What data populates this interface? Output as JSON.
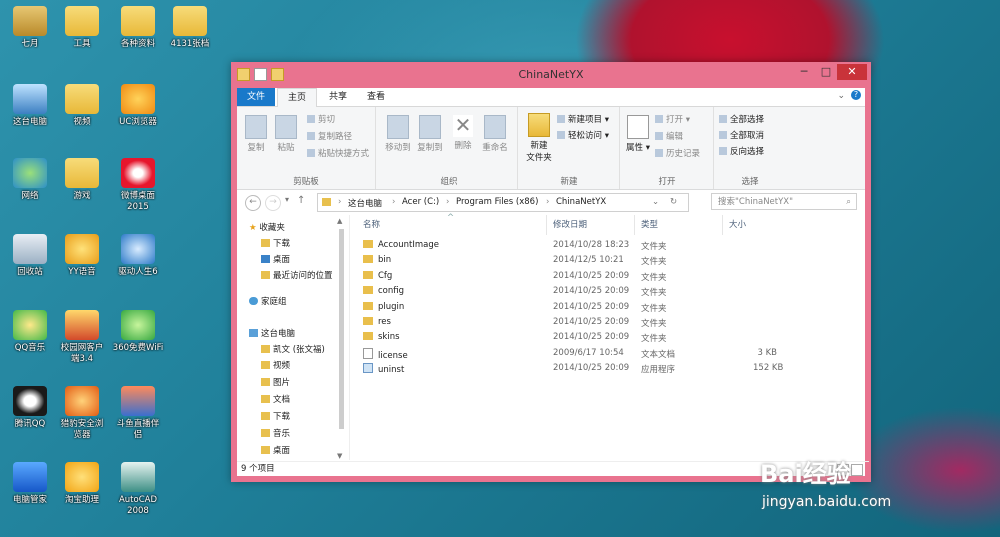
{
  "desktop": {
    "icons": [
      "七月",
      "工具",
      "各种资料",
      "4131张档",
      "这台电脑",
      "视频",
      "UC浏览器",
      "网络",
      "游戏",
      "微博桌面\n2015",
      "回收站",
      "YY语音",
      "驱动人生6",
      "QQ音乐",
      "校园网客户\n端3.4",
      "360免费WiFi",
      "腾讯QQ",
      "猎豹安全浏\n览器",
      "斗鱼直播伴\n侣",
      "电脑管家",
      "淘宝助理",
      "AutoCAD\n2008"
    ]
  },
  "window": {
    "title": "ChinaNetYX",
    "controls": {
      "minimize": "─",
      "maximize": "□",
      "close": "✕"
    },
    "tabs": {
      "file": "文件",
      "home": "主页",
      "share": "共享",
      "view": "查看"
    },
    "ribbon": {
      "clipboard": {
        "copy": "复制",
        "paste": "粘贴",
        "cut": "剪切",
        "copy_path": "复制路径",
        "paste_shortcut": "粘贴快捷方式",
        "label": "剪贴板"
      },
      "organize": {
        "move_to": "移动到",
        "copy_to": "复制到",
        "delete": "删除",
        "rename": "重命名",
        "label": "组织"
      },
      "new": {
        "new_folder": "新建\n文件夹",
        "new_item": "新建项目",
        "easy_access": "轻松访问",
        "label": "新建"
      },
      "open": {
        "properties": "属性",
        "open": "打开",
        "edit": "编辑",
        "history": "历史记录",
        "label": "打开"
      },
      "select": {
        "select_all": "全部选择",
        "select_none": "全部取消",
        "invert": "反向选择",
        "label": "选择"
      }
    },
    "address": {
      "crumbs": [
        "这台电脑",
        "Acer (C:)",
        "Program Files (x86)",
        "ChinaNetYX"
      ],
      "search_placeholder": "搜索\"ChinaNetYX\""
    },
    "nav": {
      "favorites": "收藏夹",
      "downloads": "下载",
      "desktop": "桌面",
      "recent": "最近访问的位置",
      "homegroup": "家庭组",
      "thispc": "这台电脑",
      "pc_items": [
        "凯文 (张文福)",
        "视频",
        "图片",
        "文档",
        "下载",
        "音乐",
        "桌面"
      ]
    },
    "columns": {
      "name": "名称",
      "date": "修改日期",
      "type": "类型",
      "size": "大小"
    },
    "files": [
      {
        "name": "AccountImage",
        "date": "2014/10/28 18:23",
        "type": "文件夹",
        "size": "",
        "kind": "folder"
      },
      {
        "name": "bin",
        "date": "2014/12/5 10:21",
        "type": "文件夹",
        "size": "",
        "kind": "folder"
      },
      {
        "name": "Cfg",
        "date": "2014/10/25 20:09",
        "type": "文件夹",
        "size": "",
        "kind": "folder"
      },
      {
        "name": "config",
        "date": "2014/10/25 20:09",
        "type": "文件夹",
        "size": "",
        "kind": "folder"
      },
      {
        "name": "plugin",
        "date": "2014/10/25 20:09",
        "type": "文件夹",
        "size": "",
        "kind": "folder"
      },
      {
        "name": "res",
        "date": "2014/10/25 20:09",
        "type": "文件夹",
        "size": "",
        "kind": "folder"
      },
      {
        "name": "skins",
        "date": "2014/10/25 20:09",
        "type": "文件夹",
        "size": "",
        "kind": "folder"
      },
      {
        "name": "license",
        "date": "2009/6/17 10:54",
        "type": "文本文档",
        "size": "3 KB",
        "kind": "doc"
      },
      {
        "name": "uninst",
        "date": "2014/10/25 20:09",
        "type": "应用程序",
        "size": "152 KB",
        "kind": "app"
      }
    ],
    "status": "9 个项目"
  },
  "watermark": {
    "brand": "Bai经验",
    "url": "jingyan.baidu.com"
  }
}
